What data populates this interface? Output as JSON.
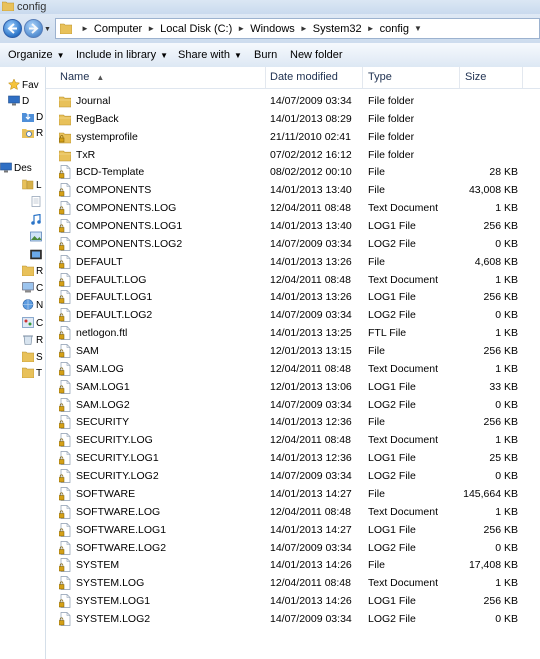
{
  "window": {
    "title": "config"
  },
  "address": {
    "crumbs": [
      "Computer",
      "Local Disk (C:)",
      "Windows",
      "System32",
      "config"
    ]
  },
  "toolbar": {
    "organize": "Organize",
    "include": "Include in library",
    "share": "Share with",
    "burn": "Burn",
    "new_folder": "New folder"
  },
  "nav": [
    {
      "label": "Fav",
      "icon": "favorites-star-icon"
    },
    {
      "label": "D",
      "icon": "desktop-icon"
    },
    {
      "label": "D",
      "icon": "downloads-icon"
    },
    {
      "label": "R",
      "icon": "recent-places-icon"
    },
    {
      "label": "Des",
      "icon": "desktop-icon"
    },
    {
      "label": "L",
      "icon": "libraries-icon"
    },
    {
      "label": "",
      "icon": "documents-icon"
    },
    {
      "label": "",
      "icon": "music-icon"
    },
    {
      "label": "",
      "icon": "pictures-icon"
    },
    {
      "label": "",
      "icon": "videos-icon"
    },
    {
      "label": "R",
      "icon": "folder-icon"
    },
    {
      "label": "C",
      "icon": "computer-icon"
    },
    {
      "label": "N",
      "icon": "network-icon"
    },
    {
      "label": "C",
      "icon": "control-panel-icon"
    },
    {
      "label": "R",
      "icon": "recycle-bin-icon"
    },
    {
      "label": "S",
      "icon": "folder-icon"
    },
    {
      "label": "T",
      "icon": "folder-icon"
    }
  ],
  "columns": {
    "name": "Name",
    "date": "Date modified",
    "type": "Type",
    "size": "Size"
  },
  "files": [
    {
      "name": "Journal",
      "date": "14/07/2009 03:34",
      "type": "File folder",
      "size": "",
      "kind": "folder"
    },
    {
      "name": "RegBack",
      "date": "14/01/2013 08:29",
      "type": "File folder",
      "size": "",
      "kind": "folder"
    },
    {
      "name": "systemprofile",
      "date": "21/11/2010 02:41",
      "type": "File folder",
      "size": "",
      "kind": "folder-locked"
    },
    {
      "name": "TxR",
      "date": "07/02/2012 16:12",
      "type": "File folder",
      "size": "",
      "kind": "folder"
    },
    {
      "name": "BCD-Template",
      "date": "08/02/2012 00:10",
      "type": "File",
      "size": "28 KB",
      "kind": "file-locked"
    },
    {
      "name": "COMPONENTS",
      "date": "14/01/2013 13:40",
      "type": "File",
      "size": "43,008 KB",
      "kind": "file-locked"
    },
    {
      "name": "COMPONENTS.LOG",
      "date": "12/04/2011 08:48",
      "type": "Text Document",
      "size": "1 KB",
      "kind": "file-locked"
    },
    {
      "name": "COMPONENTS.LOG1",
      "date": "14/01/2013 13:40",
      "type": "LOG1 File",
      "size": "256 KB",
      "kind": "file-locked"
    },
    {
      "name": "COMPONENTS.LOG2",
      "date": "14/07/2009 03:34",
      "type": "LOG2 File",
      "size": "0 KB",
      "kind": "file-locked"
    },
    {
      "name": "DEFAULT",
      "date": "14/01/2013 13:26",
      "type": "File",
      "size": "4,608 KB",
      "kind": "file-locked"
    },
    {
      "name": "DEFAULT.LOG",
      "date": "12/04/2011 08:48",
      "type": "Text Document",
      "size": "1 KB",
      "kind": "file-locked"
    },
    {
      "name": "DEFAULT.LOG1",
      "date": "14/01/2013 13:26",
      "type": "LOG1 File",
      "size": "256 KB",
      "kind": "file-locked"
    },
    {
      "name": "DEFAULT.LOG2",
      "date": "14/07/2009 03:34",
      "type": "LOG2 File",
      "size": "0 KB",
      "kind": "file-locked"
    },
    {
      "name": "netlogon.ftl",
      "date": "14/01/2013 13:25",
      "type": "FTL File",
      "size": "1 KB",
      "kind": "file-locked"
    },
    {
      "name": "SAM",
      "date": "12/01/2013 13:15",
      "type": "File",
      "size": "256 KB",
      "kind": "file-locked"
    },
    {
      "name": "SAM.LOG",
      "date": "12/04/2011 08:48",
      "type": "Text Document",
      "size": "1 KB",
      "kind": "file-locked"
    },
    {
      "name": "SAM.LOG1",
      "date": "12/01/2013 13:06",
      "type": "LOG1 File",
      "size": "33 KB",
      "kind": "file-locked"
    },
    {
      "name": "SAM.LOG2",
      "date": "14/07/2009 03:34",
      "type": "LOG2 File",
      "size": "0 KB",
      "kind": "file-locked"
    },
    {
      "name": "SECURITY",
      "date": "14/01/2013 12:36",
      "type": "File",
      "size": "256 KB",
      "kind": "file-locked"
    },
    {
      "name": "SECURITY.LOG",
      "date": "12/04/2011 08:48",
      "type": "Text Document",
      "size": "1 KB",
      "kind": "file-locked"
    },
    {
      "name": "SECURITY.LOG1",
      "date": "14/01/2013 12:36",
      "type": "LOG1 File",
      "size": "25 KB",
      "kind": "file-locked"
    },
    {
      "name": "SECURITY.LOG2",
      "date": "14/07/2009 03:34",
      "type": "LOG2 File",
      "size": "0 KB",
      "kind": "file-locked"
    },
    {
      "name": "SOFTWARE",
      "date": "14/01/2013 14:27",
      "type": "File",
      "size": "145,664 KB",
      "kind": "file-locked"
    },
    {
      "name": "SOFTWARE.LOG",
      "date": "12/04/2011 08:48",
      "type": "Text Document",
      "size": "1 KB",
      "kind": "file-locked"
    },
    {
      "name": "SOFTWARE.LOG1",
      "date": "14/01/2013 14:27",
      "type": "LOG1 File",
      "size": "256 KB",
      "kind": "file-locked"
    },
    {
      "name": "SOFTWARE.LOG2",
      "date": "14/07/2009 03:34",
      "type": "LOG2 File",
      "size": "0 KB",
      "kind": "file-locked"
    },
    {
      "name": "SYSTEM",
      "date": "14/01/2013 14:26",
      "type": "File",
      "size": "17,408 KB",
      "kind": "file-locked"
    },
    {
      "name": "SYSTEM.LOG",
      "date": "12/04/2011 08:48",
      "type": "Text Document",
      "size": "1 KB",
      "kind": "file-locked"
    },
    {
      "name": "SYSTEM.LOG1",
      "date": "14/01/2013 14:26",
      "type": "LOG1 File",
      "size": "256 KB",
      "kind": "file-locked"
    },
    {
      "name": "SYSTEM.LOG2",
      "date": "14/07/2009 03:34",
      "type": "LOG2 File",
      "size": "0 KB",
      "kind": "file-locked"
    }
  ]
}
